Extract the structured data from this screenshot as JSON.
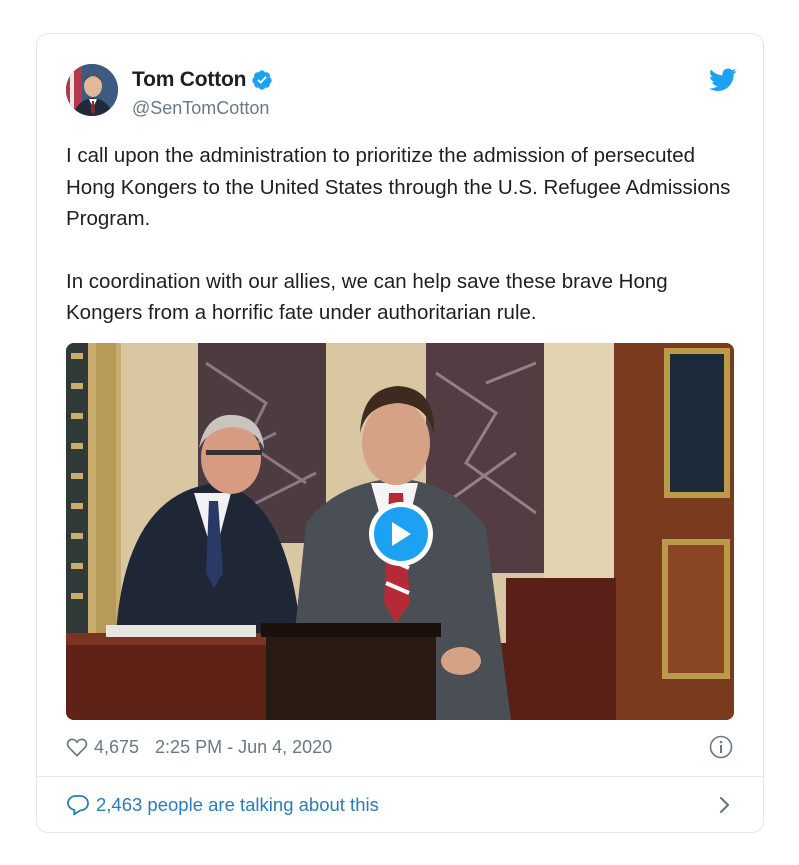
{
  "user": {
    "display_name": "Tom Cotton",
    "handle": "@SenTomCotton",
    "verified": true
  },
  "tweet": {
    "paragraphs": [
      "I call upon the administration to prioritize the admission of persecuted Hong Kongers to the United States through the U.S. Refugee Admissions Program.",
      "In coordination with our allies, we can help save these brave Hong Kongers from a horrific fate under authoritarian rule."
    ]
  },
  "meta": {
    "likes": "4,675",
    "timestamp": "2:25 PM - Jun 4, 2020"
  },
  "footer": {
    "talking_text": "2,463 people are talking about this"
  },
  "icons": {
    "brand": "twitter-bird-icon",
    "verified": "verified-badge-icon",
    "like": "heart-icon",
    "info": "info-icon",
    "reply": "speech-bubble-icon",
    "more": "chevron-right-icon",
    "media": "play-icon"
  },
  "colors": {
    "accent": "#1da1f2",
    "link": "#2b7bb9",
    "muted": "#697882",
    "text": "#1c2022",
    "border": "#e1e8ed"
  }
}
